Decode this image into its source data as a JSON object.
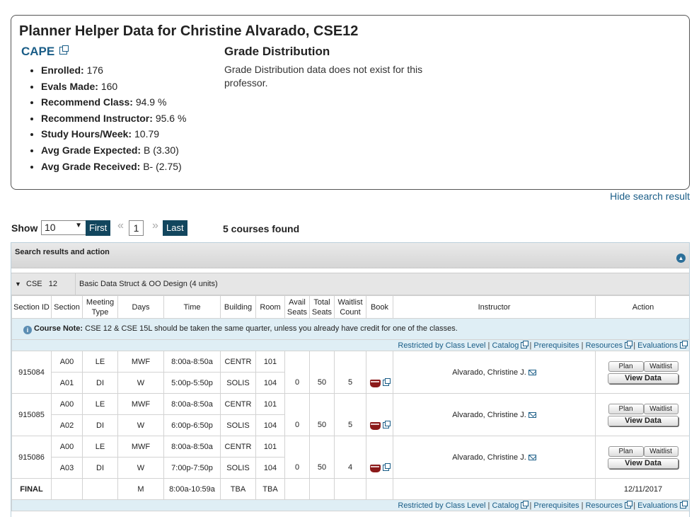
{
  "helper": {
    "title": "Planner Helper Data for Christine Alvarado, CSE12",
    "cape_label": "CAPE",
    "stats": [
      {
        "label": "Enrolled:",
        "value": "176"
      },
      {
        "label": "Evals Made:",
        "value": "160"
      },
      {
        "label": "Recommend Class:",
        "value": "94.9 %"
      },
      {
        "label": "Recommend Instructor:",
        "value": "95.6 %"
      },
      {
        "label": "Study Hours/Week:",
        "value": "10.79"
      },
      {
        "label": "Avg Grade Expected:",
        "value": "B (3.30)"
      },
      {
        "label": "Avg Grade Received:",
        "value": "B- (2.75)"
      }
    ],
    "grade_title": "Grade Distribution",
    "grade_text": "Grade Distribution data does not exist for this professor."
  },
  "hide_link": "Hide search result",
  "pager": {
    "show_label": "Show",
    "show_value": "10",
    "first": "First",
    "prev": "«",
    "page": "1",
    "next": "»",
    "last": "Last",
    "found": "5 courses found"
  },
  "panel": {
    "header": "Search results and action",
    "course_code": "CSE   12",
    "course_title": "Basic Data Struct & OO Design (4 units)"
  },
  "columns": [
    "Section ID",
    "Section",
    "Meeting Type",
    "Days",
    "Time",
    "Building",
    "Room",
    "Avail Seats",
    "Total Seats",
    "Waitlist Count",
    "Book",
    "Instructor",
    "Action"
  ],
  "note": {
    "label": "Course Note:",
    "text": "CSE 12 & CSE 15L should be taken the same quarter, unless you already have credit for one of the classes."
  },
  "links": {
    "restricted": "Restricted by Class Level",
    "catalog": "Catalog",
    "prereq": "Prerequisites",
    "resources": "Resources",
    "evaluations": "Evaluations",
    "sep": "|"
  },
  "sections": [
    {
      "id": "915084",
      "lecture": {
        "section": "A00",
        "type": "LE",
        "days": "MWF",
        "time": "8:00a-8:50a",
        "building": "CENTR",
        "room": "101"
      },
      "discussion": {
        "section": "A01",
        "type": "DI",
        "days": "W",
        "time": "5:00p-5:50p",
        "building": "SOLIS",
        "room": "104",
        "avail": "0",
        "total": "50",
        "waitlist": "5"
      },
      "instructor": "Alvarado, Christine J."
    },
    {
      "id": "915085",
      "lecture": {
        "section": "A00",
        "type": "LE",
        "days": "MWF",
        "time": "8:00a-8:50a",
        "building": "CENTR",
        "room": "101"
      },
      "discussion": {
        "section": "A02",
        "type": "DI",
        "days": "W",
        "time": "6:00p-6:50p",
        "building": "SOLIS",
        "room": "104",
        "avail": "0",
        "total": "50",
        "waitlist": "5"
      },
      "instructor": "Alvarado, Christine J."
    },
    {
      "id": "915086",
      "lecture": {
        "section": "A00",
        "type": "LE",
        "days": "MWF",
        "time": "8:00a-8:50a",
        "building": "CENTR",
        "room": "101"
      },
      "discussion": {
        "section": "A03",
        "type": "DI",
        "days": "W",
        "time": "7:00p-7:50p",
        "building": "SOLIS",
        "room": "104",
        "avail": "0",
        "total": "50",
        "waitlist": "4"
      },
      "instructor": "Alvarado, Christine J."
    }
  ],
  "buttons": {
    "plan": "Plan",
    "waitlist": "Waitlist",
    "view": "View Data"
  },
  "final": {
    "label": "FINAL",
    "days": "M",
    "time": "8:00a-10:59a",
    "building": "TBA",
    "room": "TBA",
    "date": "12/11/2017"
  }
}
